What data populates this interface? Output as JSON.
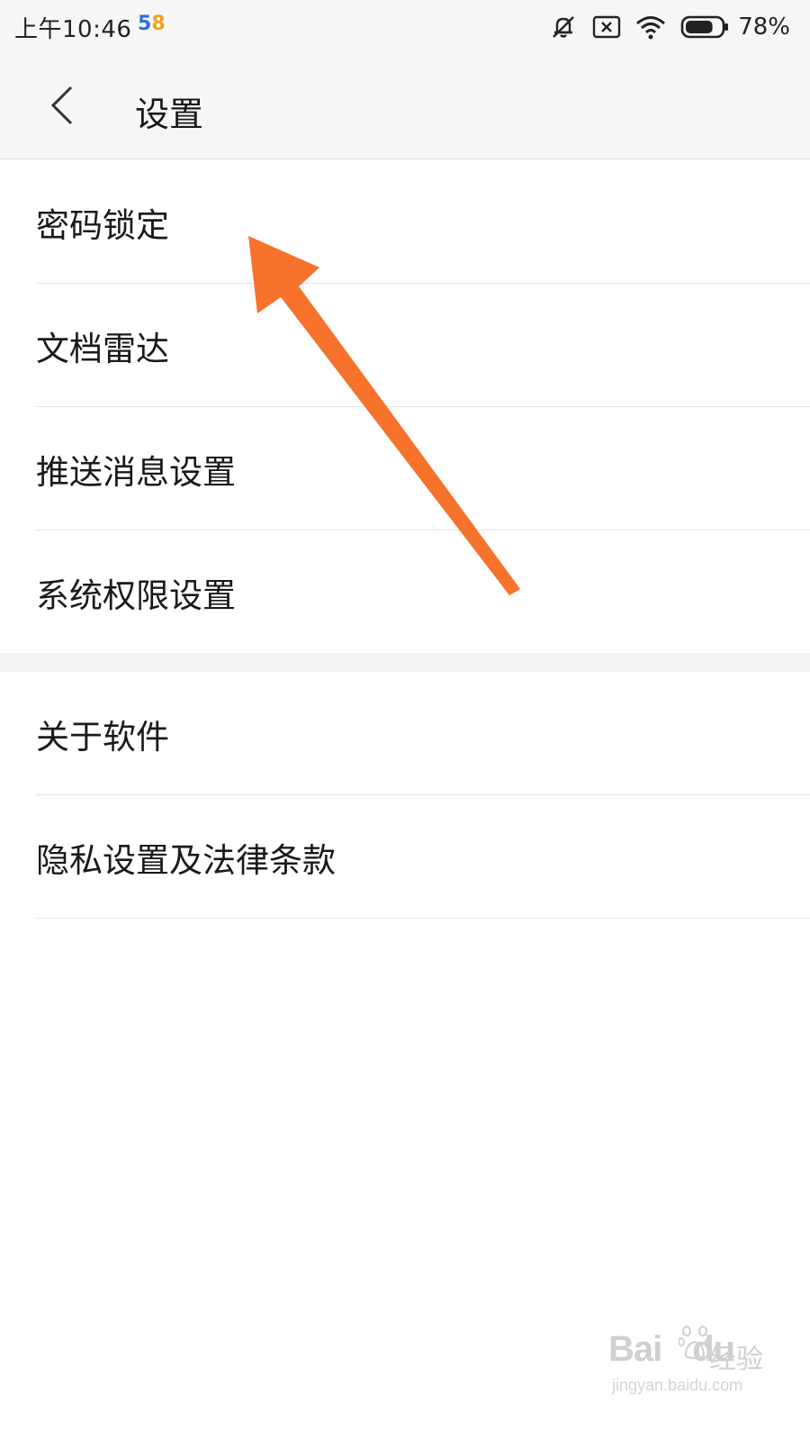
{
  "status_bar": {
    "time": "上午10:46",
    "app_badge": {
      "digit_1": "5",
      "digit_2": "8"
    },
    "icons": [
      "mute-icon",
      "sim-off-icon",
      "wifi-icon",
      "battery-icon"
    ],
    "battery_percent": "78%",
    "battery_level": 0.78
  },
  "nav": {
    "back_icon": "chevron-left-icon",
    "title": "设置"
  },
  "settings_group_1": [
    {
      "label": "密码锁定"
    },
    {
      "label": "文档雷达"
    },
    {
      "label": "推送消息设置"
    },
    {
      "label": "系统权限设置"
    }
  ],
  "settings_group_2": [
    {
      "label": "关于软件"
    },
    {
      "label": "隐私设置及法律条款"
    }
  ],
  "annotation": {
    "arrow_color": "#F7722A",
    "points_to": "密码锁定"
  },
  "watermark": {
    "brand": "Bai",
    "brand_suffix": "du",
    "brand_cn": "经验",
    "url": "jingyan.baidu.com"
  }
}
